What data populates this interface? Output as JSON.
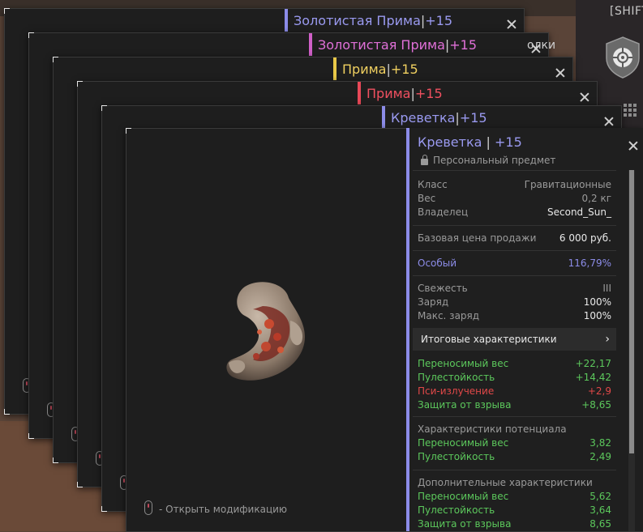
{
  "hud": {
    "shift_label": "[SHIFT]",
    "partial_label": "олки"
  },
  "windows": [
    {
      "name": "Золотистая Прима",
      "sep": " | ",
      "level": "+15",
      "color": "#9a9af0",
      "bar": "#8c8ce8"
    },
    {
      "name": "Золотистая Прима",
      "sep": " | ",
      "level": "+15",
      "color": "#e070d8",
      "bar": "#d060c8"
    },
    {
      "name": "Прима",
      "sep": " | ",
      "level": "+15",
      "color": "#f0d060",
      "bar": "#e8c848"
    },
    {
      "name": "Прима",
      "sep": " | ",
      "level": "+15",
      "color": "#f05060",
      "bar": "#e84858"
    },
    {
      "name": "Креветка",
      "sep": " | ",
      "level": "+15",
      "color": "#9a9af0",
      "bar": "#8c8ce8"
    }
  ],
  "item": {
    "title": "Креветка",
    "sep": " | ",
    "level": "+15",
    "subtitle": "Персональный предмет",
    "open_mod": "- Открыть модификацию",
    "base_info": [
      {
        "k": "Класс",
        "v": "Гравитационные"
      },
      {
        "k": "Вес",
        "v": "0,2 кг"
      },
      {
        "k": "Владелец",
        "v": "Second_Sun_"
      }
    ],
    "price": {
      "k": "Базовая цена продажи",
      "v": "6 000 руб."
    },
    "rarity": {
      "k": "Особый",
      "v": "116,79%"
    },
    "state": [
      {
        "k": "Свежесть",
        "v": "III"
      },
      {
        "k": "Заряд",
        "v": "100%"
      },
      {
        "k": "Макс. заряд",
        "v": "100%"
      }
    ],
    "totals_button": "Итоговые характеристики",
    "totals_chevron": "›",
    "totals": [
      {
        "k": "Переносимый вес",
        "v": "+22,17",
        "c": "g"
      },
      {
        "k": "Пулестойкость",
        "v": "+14,42",
        "c": "g"
      },
      {
        "k": "Пси-излучение",
        "v": "+2,9",
        "c": "r"
      },
      {
        "k": "Защита от взрыва",
        "v": "+8,65",
        "c": "g"
      }
    ],
    "potential_title": "Характеристики потенциала",
    "potential": [
      {
        "k": "Переносимый вес",
        "v": "3,82"
      },
      {
        "k": "Пулестойкость",
        "v": "2,49"
      }
    ],
    "extra_title": "Дополнительные характеристики",
    "extra": [
      {
        "k": "Переносимый вес",
        "v": "5,62"
      },
      {
        "k": "Пулестойкость",
        "v": "3,64"
      },
      {
        "k": "Защита от взрыва",
        "v": "8,65"
      }
    ]
  }
}
